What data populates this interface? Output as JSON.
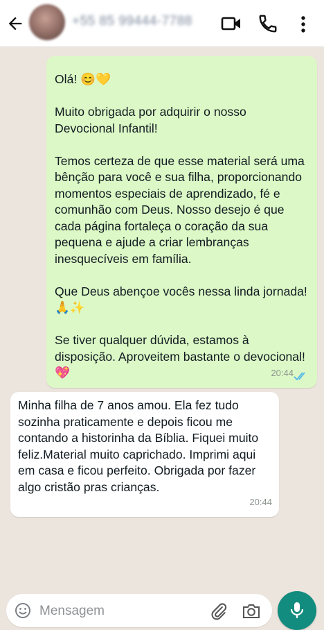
{
  "header": {
    "contact_name": "+55 85 99444-7788",
    "icons": {
      "back": "back-arrow-icon",
      "video": "video-call-icon",
      "call": "phone-call-icon",
      "menu": "more-options-icon"
    }
  },
  "messages": [
    {
      "direction": "outgoing",
      "paragraphs": [
        "Olá! 😊💛",
        "Muito obrigada por adquirir o nosso Devocional Infantil!",
        "Temos certeza de que esse material será uma bênção para você e sua filha, proporcionando momentos especiais de aprendizado, fé e comunhão com Deus. Nosso desejo é que cada página fortaleça o coração da sua pequena e ajude a criar lembranças inesquecíveis em família.",
        "Que Deus abençoe vocês nessa linda jornada! 🙏✨",
        "Se tiver qualquer dúvida, estamos à disposição. Aproveitem bastante o devocional! 💖"
      ],
      "time": "20:44",
      "status": "read"
    },
    {
      "direction": "incoming",
      "paragraphs": [
        "Minha filha de 7 anos amou. Ela fez tudo sozinha praticamente e depois ficou me contando a historinha da Bíblia. Fiquei muito feliz.Material muito caprichado. Imprimi aqui em casa e ficou perfeito. Obrigada por fazer algo cristão pras crianças."
      ],
      "time": "20:44"
    }
  ],
  "composer": {
    "placeholder": "Mensagem",
    "icons": {
      "emoji": "emoji-icon",
      "attach": "attach-clip-icon",
      "camera": "camera-icon",
      "mic": "microphone-icon"
    }
  },
  "colors": {
    "outgoing_bubble": "#DCF8C6",
    "incoming_bubble": "#FFFFFF",
    "chat_background": "#ECE5DD",
    "accent": "#128C7E",
    "read_ticks": "#4FB6EC"
  }
}
